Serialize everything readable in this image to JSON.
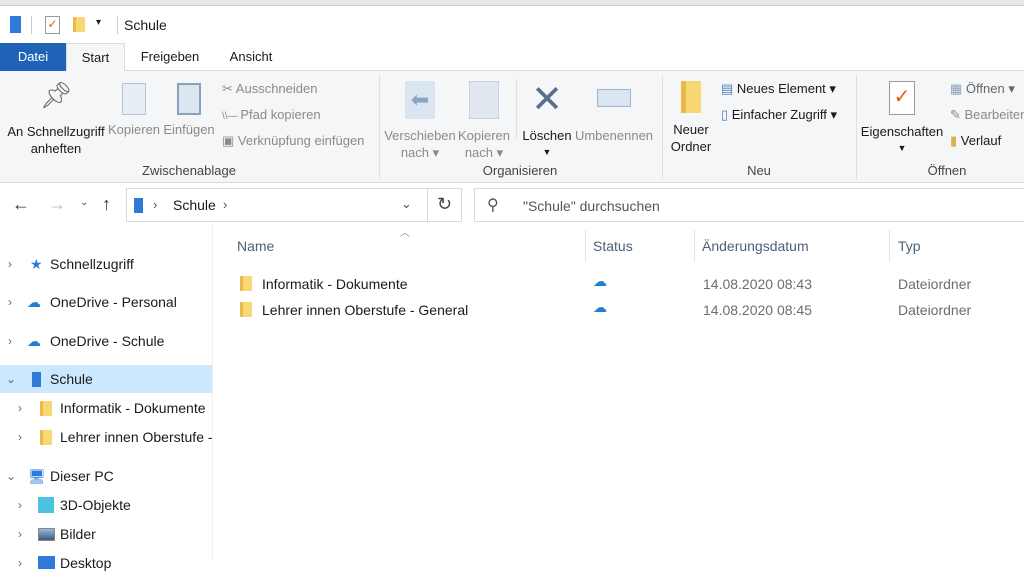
{
  "window": {
    "title": "Schule"
  },
  "tabs": [
    "Datei",
    "Start",
    "Freigeben",
    "Ansicht"
  ],
  "ribbon": {
    "zwischenablage": {
      "pin": [
        "An Schnellzugriff",
        "anheften"
      ],
      "copy": "Kopieren",
      "paste": "Einfügen",
      "cut": "Ausschneiden",
      "copy_path": "Pfad kopieren",
      "paste_shortcut": "Verknüpfung einfügen",
      "label": "Zwischenablage"
    },
    "organisieren": {
      "move": [
        "Verschieben",
        "nach"
      ],
      "copyto": [
        "Kopieren",
        "nach"
      ],
      "delete": "Löschen",
      "rename": "Umbenennen",
      "label": "Organisieren"
    },
    "neu": {
      "new_folder": [
        "Neuer",
        "Ordner"
      ],
      "new_item": "Neues Element",
      "easy_access": "Einfacher Zugriff",
      "label": "Neu"
    },
    "oeffnen": {
      "properties": "Eigenschaften",
      "open": "Öffnen",
      "edit": "Bearbeiten",
      "history": "Verlauf",
      "label": "Öffnen"
    }
  },
  "address": {
    "path": "Schule",
    "search_placeholder": "\"Schule\" durchsuchen"
  },
  "sidebar": [
    {
      "label": "Schnellzugriff"
    },
    {
      "label": "OneDrive - Personal"
    },
    {
      "label": "OneDrive - Schule"
    },
    {
      "label": "Schule"
    },
    {
      "label": "Informatik - Dokumente"
    },
    {
      "label": "Lehrer innen Oberstufe - General"
    },
    {
      "label": "Dieser PC"
    },
    {
      "label": "3D-Objekte"
    },
    {
      "label": "Bilder"
    },
    {
      "label": "Desktop"
    }
  ],
  "columns": [
    "Name",
    "Status",
    "Änderungsdatum",
    "Typ"
  ],
  "files": [
    {
      "name": "Informatik - Dokumente",
      "date": "14.08.2020 08:43",
      "type": "Dateiordner"
    },
    {
      "name": "Lehrer innen Oberstufe - General",
      "date": "14.08.2020 08:45",
      "type": "Dateiordner"
    }
  ]
}
